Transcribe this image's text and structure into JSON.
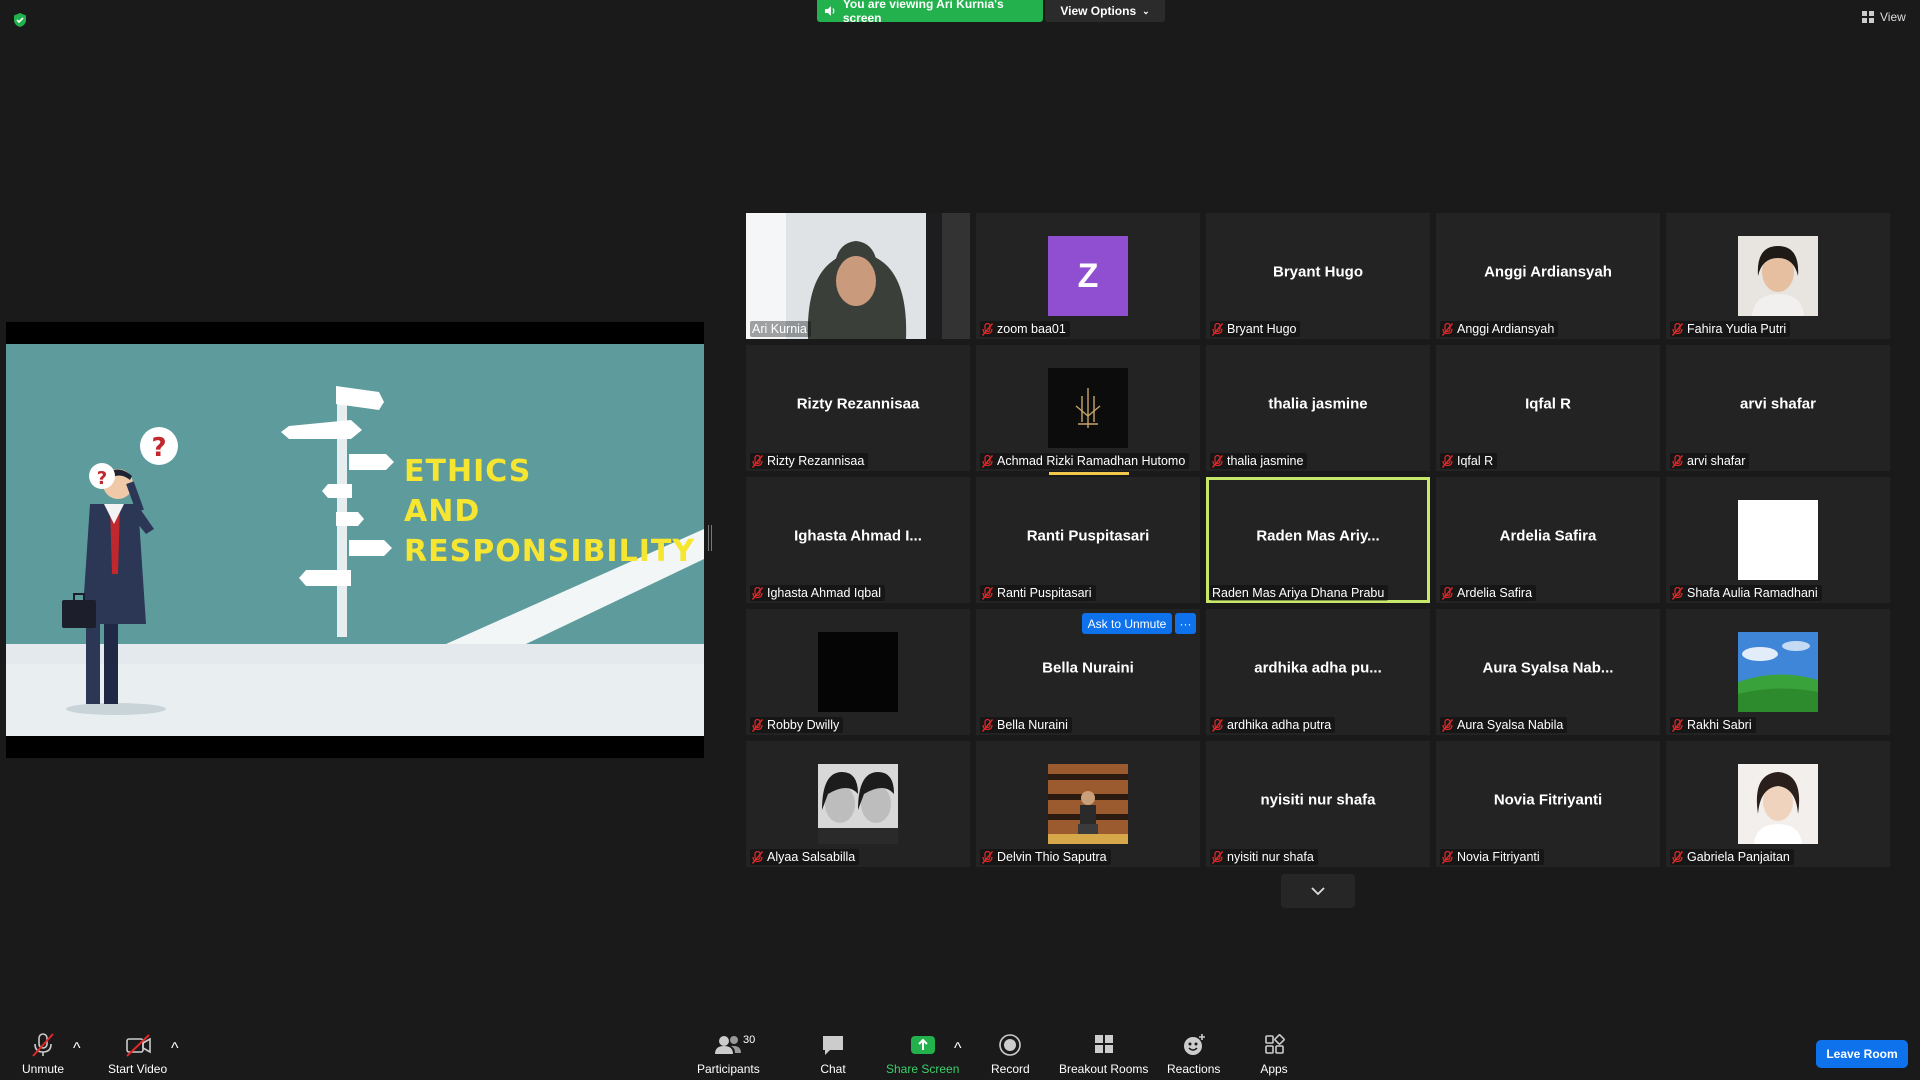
{
  "top": {
    "viewing_banner": "You are viewing Ari Kurnia's screen",
    "view_options": "View Options",
    "view": "View"
  },
  "shared_screen": {
    "slide_lines": [
      "ETHICS",
      "AND",
      "RESPONSIBILITY"
    ]
  },
  "participants": [
    {
      "label": "Ari Kurnia",
      "video": "camera",
      "muted": false
    },
    {
      "label": "zoom baa01",
      "avatar_letter": "Z",
      "avatar_color": "#8f4fd0",
      "muted": true
    },
    {
      "label": "Bryant Hugo",
      "display": "Bryant Hugo",
      "muted": true
    },
    {
      "label": "Anggi Ardiansyah",
      "display": "Anggi Ardiansyah",
      "muted": true
    },
    {
      "label": "Fahira Yudia Putri",
      "avatar": "photo",
      "muted": true
    },
    {
      "label": "Rizty Rezannisaa",
      "display": "Rizty Rezannisaa",
      "muted": true
    },
    {
      "label": "Achmad Rizki Ramadhan Hutomo",
      "avatar": "logo",
      "muted": true
    },
    {
      "label": "thalia jasmine",
      "display": "thalia jasmine",
      "muted": true
    },
    {
      "label": "Iqfal R",
      "display": "Iqfal R",
      "muted": true
    },
    {
      "label": "arvi shafar",
      "display": "arvi shafar",
      "muted": true
    },
    {
      "label": "Ighasta Ahmad Iqbal",
      "display": "Ighasta Ahmad I...",
      "muted": true
    },
    {
      "label": "Ranti Puspitasari",
      "display": "Ranti Puspitasari",
      "muted": true
    },
    {
      "label": "Raden Mas Ariya Dhana Prabu",
      "display": "Raden Mas Ariy...",
      "muted": false,
      "active": true
    },
    {
      "label": "Ardelia Safira",
      "display": "Ardelia Safira",
      "muted": true
    },
    {
      "label": "Shafa Aulia Ramadhani",
      "avatar": "white",
      "muted": true
    },
    {
      "label": "Robby Dwilly",
      "avatar": "black",
      "muted": true
    },
    {
      "label": "Bella Nuraini",
      "display": "Bella Nuraini",
      "muted": true
    },
    {
      "label": "ardhika adha putra",
      "display": "ardhika adha pu...",
      "muted": true
    },
    {
      "label": "Aura Syalsa Nabila",
      "display": "Aura Syalsa Nab...",
      "muted": true
    },
    {
      "label": "Rakhi Sabri",
      "avatar": "landscape",
      "muted": true
    },
    {
      "label": "Alyaa Salsabilla",
      "avatar": "photo-bw",
      "muted": true
    },
    {
      "label": "Delvin Thio Saputra",
      "avatar": "photo-warm",
      "muted": true
    },
    {
      "label": "nyisiti nur shafa",
      "display": "nyisiti nur shafa",
      "muted": true
    },
    {
      "label": "Novia Fitriyanti",
      "display": "Novia Fitriyanti",
      "muted": true
    },
    {
      "label": "Gabriela Panjaitan",
      "avatar": "photo-light",
      "muted": true
    }
  ],
  "hover": {
    "ask_unmute": "Ask to Unmute",
    "more": "···"
  },
  "toolbar": {
    "unmute": "Unmute",
    "start_video": "Start Video",
    "participants": "Participants",
    "participants_count": "30",
    "chat": "Chat",
    "share_screen": "Share Screen",
    "record": "Record",
    "breakout_rooms": "Breakout Rooms",
    "reactions": "Reactions",
    "apps": "Apps",
    "leave_room": "Leave Room"
  },
  "colors": {
    "accent_blue": "#0e72ed",
    "share_green": "#22b14c",
    "mute_red": "#e02828",
    "active_speaker": "#c8e86b"
  }
}
